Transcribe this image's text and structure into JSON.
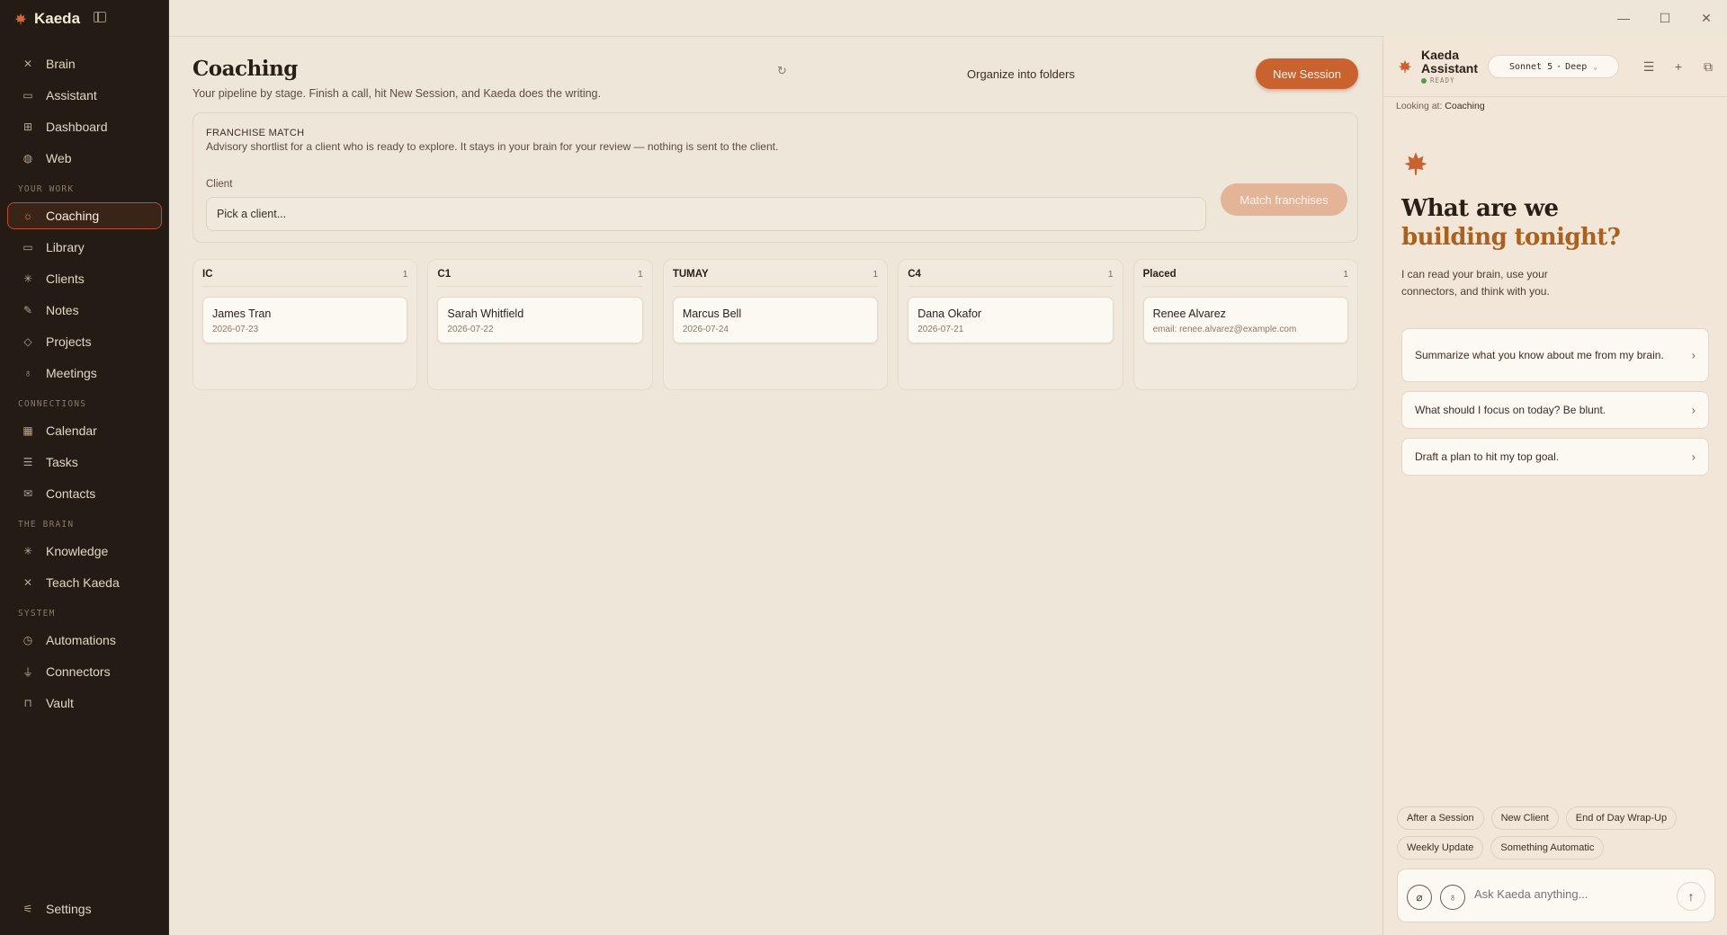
{
  "app": {
    "name": "Kaeda",
    "brand_color": "#c9622f"
  },
  "sidebar": {
    "primary": [
      {
        "label": "Brain",
        "icon": "brain-icon"
      },
      {
        "label": "Assistant",
        "icon": "chat-icon"
      },
      {
        "label": "Dashboard",
        "icon": "grid-icon"
      },
      {
        "label": "Web",
        "icon": "globe-icon"
      }
    ],
    "sections": [
      {
        "title": "YOUR WORK",
        "items": [
          {
            "label": "Coaching",
            "icon": "sun-icon",
            "active": true
          },
          {
            "label": "Library",
            "icon": "book-icon"
          },
          {
            "label": "Clients",
            "icon": "spark-icon"
          },
          {
            "label": "Notes",
            "icon": "pencil-icon"
          },
          {
            "label": "Projects",
            "icon": "diamond-icon"
          },
          {
            "label": "Meetings",
            "icon": "mic-icon"
          }
        ]
      },
      {
        "title": "CONNECTIONS",
        "items": [
          {
            "label": "Calendar",
            "icon": "calendar-icon"
          },
          {
            "label": "Tasks",
            "icon": "list-icon"
          },
          {
            "label": "Contacts",
            "icon": "mail-icon"
          }
        ]
      },
      {
        "title": "THE BRAIN",
        "items": [
          {
            "label": "Knowledge",
            "icon": "spark-icon"
          },
          {
            "label": "Teach Kaeda",
            "icon": "brain-icon"
          }
        ]
      },
      {
        "title": "SYSTEM",
        "items": [
          {
            "label": "Automations",
            "icon": "clock-icon"
          },
          {
            "label": "Connectors",
            "icon": "plug-icon"
          },
          {
            "label": "Vault",
            "icon": "lock-icon"
          }
        ]
      }
    ],
    "settings_label": "Settings"
  },
  "main": {
    "title": "Coaching",
    "subtitle": "Your pipeline by stage. Finish a call, hit New Session, and Kaeda does the writing.",
    "organize_label": "Organize into folders",
    "new_session_label": "New Session",
    "franchise": {
      "eyebrow": "FRANCHISE MATCH",
      "description": "Advisory shortlist for a client who is ready to explore. It stays in your brain for your review — nothing is sent to the client.",
      "client_label": "Client",
      "client_placeholder": "Pick a client...",
      "match_button": "Match franchises"
    },
    "stages": [
      {
        "name": "IC",
        "count": "1",
        "card": {
          "name": "James Tran",
          "meta": "2026-07-23"
        }
      },
      {
        "name": "C1",
        "count": "1",
        "card": {
          "name": "Sarah Whitfield",
          "meta": "2026-07-22"
        }
      },
      {
        "name": "TUMAY",
        "count": "1",
        "card": {
          "name": "Marcus Bell",
          "meta": "2026-07-24"
        }
      },
      {
        "name": "C4",
        "count": "1",
        "card": {
          "name": "Dana Okafor",
          "meta": "2026-07-21"
        }
      },
      {
        "name": "Placed",
        "count": "1",
        "card": {
          "name": "Renee Alvarez",
          "meta": "email: renee.alvarez@example.com"
        }
      }
    ]
  },
  "assistant": {
    "name": "Kaeda Assistant",
    "status": "READY",
    "model": "Sonnet 5",
    "mode": "Deep",
    "context_prefix": "Looking at:",
    "context_value": "Coaching",
    "hero_line1": "What are we",
    "hero_line2": "building tonight?",
    "hero_sub": "I can read your brain, use your connectors, and think with you.",
    "prompts": [
      "Summarize what you know about me from my brain.",
      "What should I focus on today? Be blunt.",
      "Draft a plan to hit my top goal."
    ],
    "chips": [
      "After a Session",
      "New Client",
      "End of Day Wrap-Up",
      "Weekly Update",
      "Something Automatic"
    ],
    "composer_placeholder": "Ask Kaeda anything..."
  }
}
